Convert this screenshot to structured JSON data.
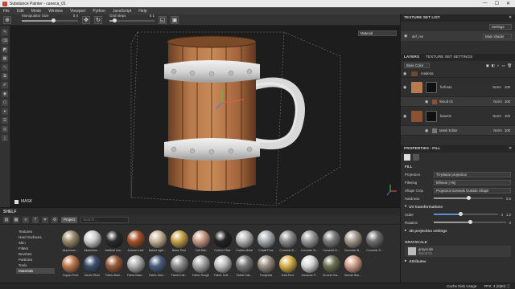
{
  "window": {
    "title": "Substance Painter - caneca_01",
    "controls": [
      "—",
      "☐",
      "✕"
    ]
  },
  "menu": [
    "File",
    "Edit",
    "Mode",
    "Window",
    "Viewport",
    "Python",
    "JavaScript",
    "Help"
  ],
  "toolbar": {
    "manipulator_size_label": "Manipulator Size",
    "manipulator_size_value": "0.4",
    "grid_steps_label": "Grid steps",
    "grid_steps_value": "0.1",
    "manipulator_size_fraction": 0.55,
    "grid_steps_fraction": 0.1
  },
  "viewport": {
    "material_select": "Material",
    "mask_label": "MASK"
  },
  "shelf": {
    "title": "SHELF",
    "filter_chip": "Project",
    "search_placeholder": "Search...",
    "categories": [
      "Textures",
      "Hard Surfaces",
      "Skin",
      "Filters",
      "Brushes",
      "Particles",
      "Tools",
      "Materials"
    ],
    "selected_category": "Materials",
    "materials": [
      {
        "name": "Aluminium ...",
        "color": "#9a8a6a"
      },
      {
        "name": "Aluminium ...",
        "color": "#cfcfcf"
      },
      {
        "name": "Artificial Lea...",
        "color": "#2b2b2b"
      },
      {
        "name": "Autumn Leaf",
        "color": "#a5532c"
      },
      {
        "name": "Baked Light...",
        "color": "#c9b49a"
      },
      {
        "name": "Brass Pure",
        "color": "#c8a24a"
      },
      {
        "name": "Calf Skin",
        "color": "#c99a86"
      },
      {
        "name": "Carbon Fiber",
        "color": "#222222"
      },
      {
        "name": "Coated Metal",
        "color": "#b7b7b7"
      },
      {
        "name": "Cobalt Pure",
        "color": "#a9afb6"
      },
      {
        "name": "Concrete B...",
        "color": "#8d8d8d"
      },
      {
        "name": "Concrete Cl...",
        "color": "#9a9a9a"
      },
      {
        "name": "Concrete D...",
        "color": "#7c7c7c"
      },
      {
        "name": "Concrete Si...",
        "color": "#a59a8c"
      },
      {
        "name": "Concrete S...",
        "color": "#6f6f6f"
      },
      {
        "name": "Copper Pure",
        "color": "#c07a4e"
      },
      {
        "name": "Denim River",
        "color": "#3b4f6b"
      },
      {
        "name": "Fabric Barn...",
        "color": "#9a5a3a"
      },
      {
        "name": "Fabric Base...",
        "color": "#b0b0b0"
      },
      {
        "name": "Fabric Deni...",
        "color": "#4b5f7f"
      },
      {
        "name": "Fabric Knit...",
        "color": "#8f8f8f"
      },
      {
        "name": "Fabric Rough",
        "color": "#a7a7a7"
      },
      {
        "name": "Fabric Soft ...",
        "color": "#c2c2c2"
      },
      {
        "name": "Fabric Suit...",
        "color": "#7a7a7a"
      },
      {
        "name": "Footprints",
        "color": "#9b8f84"
      },
      {
        "name": "Gold Pure",
        "color": "#d6b04a"
      },
      {
        "name": "Gouache P...",
        "color": "#d8d8d8"
      },
      {
        "name": "Ground Gra...",
        "color": "#6d7352"
      },
      {
        "name": "Human Bac...",
        "color": "#d3a08b"
      }
    ]
  },
  "status": {
    "cache": "Cache Disk Usage:",
    "fps": "FPS: 3 (6|60) ⓘ"
  },
  "texture_set_list": {
    "title": "TEXTURE SET LIST",
    "settings_label": "Settings",
    "item_name": "def_ms",
    "shader": "Main shader"
  },
  "layers": {
    "tabs": [
      "LAYERS",
      "TEXTURE SET SETTINGS"
    ],
    "channel": "Base Color",
    "items": [
      {
        "name": "madeira",
        "blend": "",
        "opacity": "",
        "color": "#6b4a2e"
      },
      {
        "name": "ferforas",
        "blend": "Norm",
        "opacity": "100",
        "color": "#b77b4f"
      },
      {
        "name": "base01",
        "blend": "Norm",
        "opacity": "100",
        "color": "#8a5232"
      }
    ],
    "sublayer_fill": "Wood 01",
    "sublayer_fill_blend": "Norm",
    "sublayer_fill_opacity": "100",
    "mask_editor": "Mask Editor",
    "mask_blend": "Norm",
    "mask_opacity": "100"
  },
  "properties": {
    "title": "PROPERTIES - FILL",
    "fill_section": "FILL",
    "projection_label": "Projection",
    "projection_value": "Tri-planar projection",
    "filtering_label": "Filtering",
    "filtering_value": "Bilinear | HQ",
    "shape_crop_label": "Shape Crop",
    "shape_crop_value": "Projection Extends Outside Shape",
    "hardness_label": "Hardness",
    "hardness_value": "0.5",
    "uv_section": "UV transformations",
    "scale_label": "Scale",
    "scale_value": "4",
    "scale_value2": "1.2",
    "rotation_label": "Rotation",
    "rotation_value": "0",
    "proj3d_section": "3D projection settings",
    "grayscale_section": "GRAYSCALE",
    "grayscale_item": "grayscale",
    "grayscale_sub": "Wood 01",
    "attributes_section": "Attributes",
    "hardness_fraction": 0.5,
    "scale_fraction": 0.42,
    "rotation_fraction": 0.5
  }
}
